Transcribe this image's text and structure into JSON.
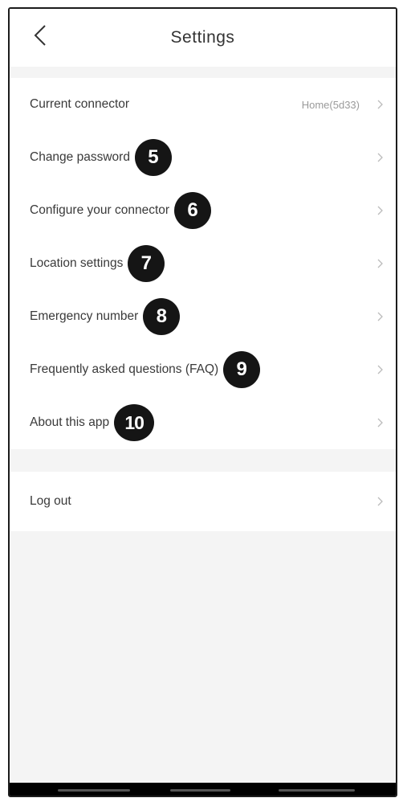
{
  "header": {
    "title": "Settings"
  },
  "settings": {
    "items": [
      {
        "label": "Current connector",
        "value": "Home(5d33)",
        "badge": ""
      },
      {
        "label": "Change password",
        "value": "",
        "badge": "5"
      },
      {
        "label": "Configure your connector",
        "value": "",
        "badge": "6"
      },
      {
        "label": "Location settings",
        "value": "",
        "badge": "7"
      },
      {
        "label": "Emergency number",
        "value": "",
        "badge": "8"
      },
      {
        "label": "Frequently asked questions (FAQ)",
        "value": "",
        "badge": "9"
      },
      {
        "label": "About this app",
        "value": "",
        "badge": "10"
      }
    ],
    "logout": {
      "label": "Log out"
    }
  },
  "icons": {
    "back": "chevron-left-icon",
    "row_arrow": "chevron-right-icon"
  },
  "colors": {
    "background": "#f4f4f4",
    "surface": "#ffffff",
    "badge": "#151515",
    "text": "#3a3a3a",
    "muted": "#9a9a9a"
  }
}
